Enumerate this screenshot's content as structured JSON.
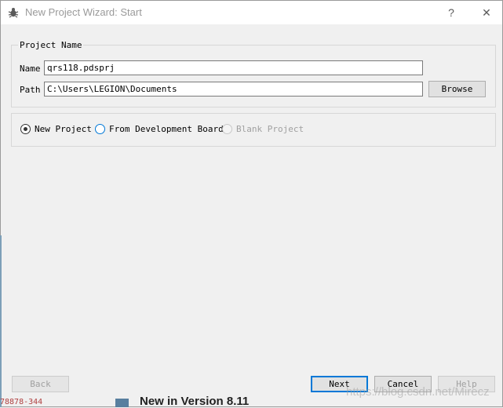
{
  "window": {
    "title": "New Project Wizard: Start",
    "help_glyph": "?",
    "close_glyph": "✕"
  },
  "project_group": {
    "title": "Project Name",
    "name_label": "Name",
    "name_value": "qrs118.pdsprj",
    "path_label": "Path",
    "path_value": "C:\\Users\\LEGION\\Documents",
    "browse_label": "Browse"
  },
  "options": {
    "items": [
      {
        "label": "New Project",
        "checked": true,
        "enabled": true
      },
      {
        "label": "From Development Board",
        "checked": false,
        "enabled": true
      },
      {
        "label": "Blank Project",
        "checked": false,
        "enabled": false
      }
    ]
  },
  "footer": {
    "back_label": "Back",
    "next_label": "Next",
    "cancel_label": "Cancel",
    "help_label": "Help"
  },
  "background": {
    "bottom_code": "78878-344",
    "bottom_title": "New in Version 8.11",
    "watermark": "https://blog.csdn.net/Mirecz"
  },
  "colors": {
    "accent": "#0078d7",
    "disabled_text": "#a0a0a0",
    "frame": "#d7d7d7"
  }
}
